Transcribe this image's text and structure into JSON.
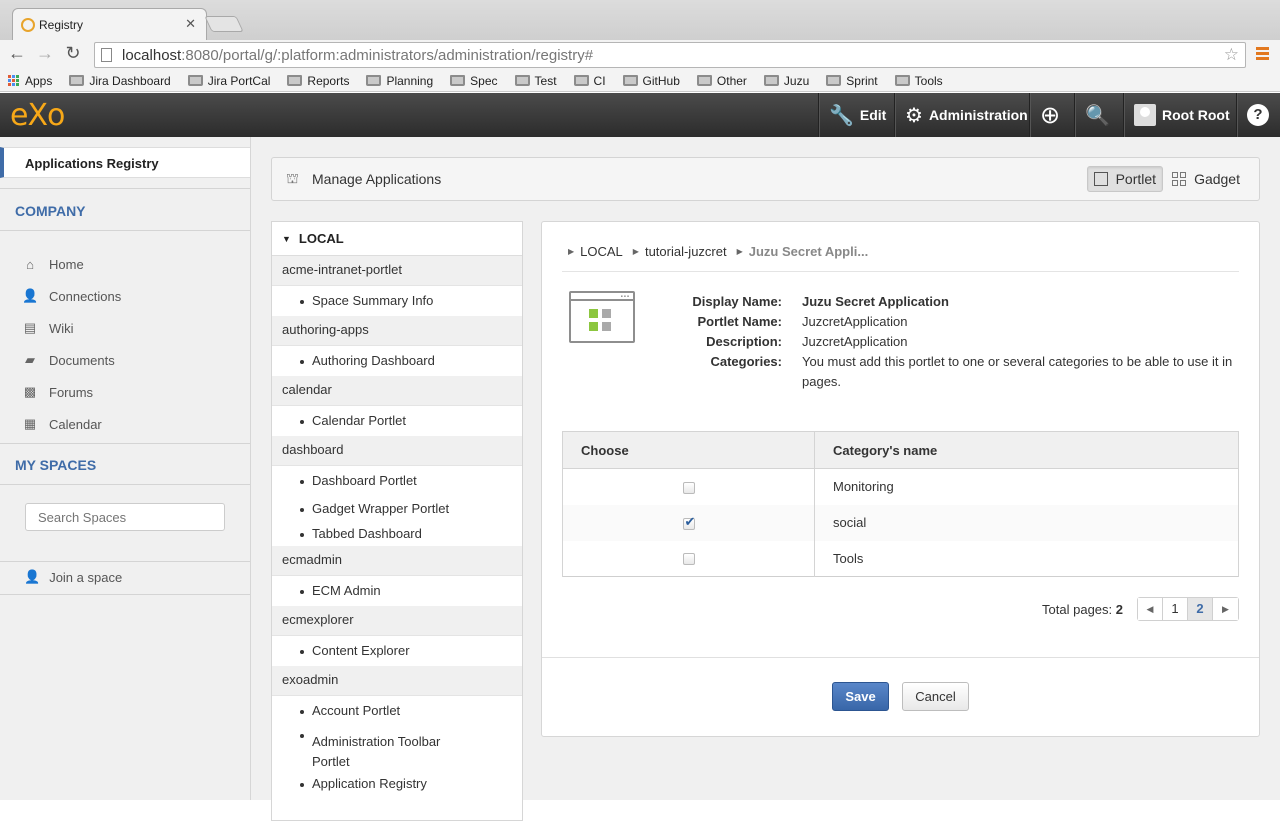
{
  "browser": {
    "tab_title": "Registry",
    "url_host": "localhost",
    "url_rest": ":8080/portal/g/:platform:administrators/administration/registry#",
    "bookmarks": [
      "Apps",
      "Jira Dashboard",
      "Jira PortCal",
      "Reports",
      "Planning",
      "Spec",
      "Test",
      "CI",
      "GitHub",
      "Other",
      "Juzu",
      "Sprint",
      "Tools"
    ]
  },
  "topbar": {
    "logo": "eXo",
    "edit": "Edit",
    "administration": "Administration",
    "user": "Root Root",
    "help": "?"
  },
  "sidebar": {
    "active_item": "Applications Registry",
    "company_title": "COMPANY",
    "company_items": [
      {
        "label": "Home",
        "icon": "home-icon"
      },
      {
        "label": "Connections",
        "icon": "user-icon"
      },
      {
        "label": "Wiki",
        "icon": "book-icon"
      },
      {
        "label": "Documents",
        "icon": "folder-icon"
      },
      {
        "label": "Forums",
        "icon": "forum-icon"
      },
      {
        "label": "Calendar",
        "icon": "calendar-icon"
      }
    ],
    "spaces_title": "MY SPACES",
    "search_placeholder": "Search Spaces",
    "join": "Join a space"
  },
  "manage": {
    "title": "Manage Applications",
    "portlet": "Portlet",
    "gadget": "Gadget"
  },
  "tree": {
    "root": "LOCAL",
    "categories": [
      {
        "name": "acme-intranet-portlet",
        "apps": [
          "Space Summary Info"
        ]
      },
      {
        "name": "authoring-apps",
        "apps": [
          "Authoring Dashboard"
        ]
      },
      {
        "name": "calendar",
        "apps": [
          "Calendar Portlet"
        ]
      },
      {
        "name": "dashboard",
        "apps": [
          "Dashboard Portlet",
          "Gadget Wrapper Portlet",
          "Tabbed Dashboard"
        ]
      },
      {
        "name": "ecmadmin",
        "apps": [
          "ECM Admin"
        ]
      },
      {
        "name": "ecmexplorer",
        "apps": [
          "Content Explorer"
        ]
      },
      {
        "name": "exoadmin",
        "apps": [
          "Account Portlet",
          "Administration Toolbar Portlet",
          "Application Registry"
        ]
      }
    ]
  },
  "detail": {
    "breadcrumb": [
      "LOCAL",
      "tutorial-juzcret",
      "Juzu Secret Appli..."
    ],
    "display_name_label": "Display Name:",
    "display_name": "Juzu Secret Application",
    "portlet_name_label": "Portlet Name:",
    "portlet_name": "JuzcretApplication",
    "description_label": "Description:",
    "description": "JuzcretApplication",
    "categories_label": "Categories:",
    "categories_text": "You must add this portlet to one or several categories to be able to use it in pages.",
    "table": {
      "col_choose": "Choose",
      "col_name": "Category's name",
      "rows": [
        {
          "name": "Monitoring",
          "checked": false
        },
        {
          "name": "social",
          "checked": true
        },
        {
          "name": "Tools",
          "checked": false
        }
      ]
    },
    "pager": {
      "label": "Total pages:",
      "total": "2",
      "pages": [
        "1",
        "2"
      ],
      "current": "2"
    },
    "save": "Save",
    "cancel": "Cancel"
  }
}
